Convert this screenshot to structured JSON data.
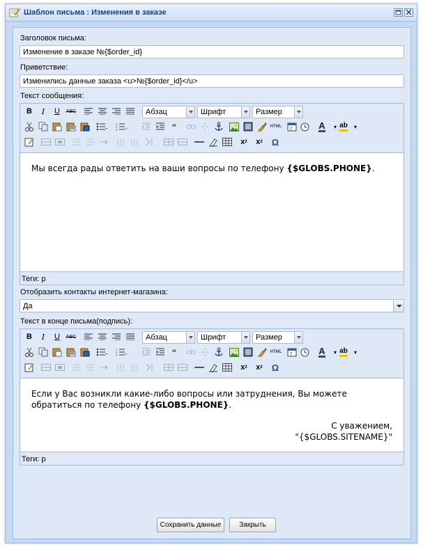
{
  "window": {
    "title": "Шаблон письма : Изменения в заказе"
  },
  "fields": {
    "subject_label": "Заголовок письма:",
    "subject_value": "Изменение в заказе №{$order_id}",
    "greeting_label": "Приветствие:",
    "greeting_value": "Изменились данные заказа <u>№{$order_id}</u>",
    "message_label": "Текст сообщения:",
    "contacts_label": "Отобразить контакты интернет-магазина:",
    "contacts_value": "Да",
    "signature_label": "Текст в конце письма(подпись):"
  },
  "toolbar": {
    "format_select": "Абзац",
    "font_select": "Шрифт",
    "size_select": "Размер"
  },
  "editor1": {
    "text_before": "Мы всегда рады ответить на ваши вопросы по телефону ",
    "text_bold": "{$GLOBS.PHONE}",
    "text_after": ".",
    "tags": "Теги: p"
  },
  "editor2": {
    "line1": "Если у Вас возникли какие-либо вопросы или затруднения, Вы можете обратиться по телефону ",
    "line1_bold": "{$GLOBS.PHONE}",
    "line1_end": ".",
    "signoff1": "С уважением,",
    "signoff2": "\"{$GLOBS.SITENAME}\"",
    "tags": "Теги: p"
  },
  "buttons": {
    "save": "Сохранить данные",
    "close": "Закрыть"
  },
  "colors": {
    "title_text": "#15428b",
    "panel_bg": "#dfe8f6",
    "window_bg": "#c6d9f1"
  }
}
